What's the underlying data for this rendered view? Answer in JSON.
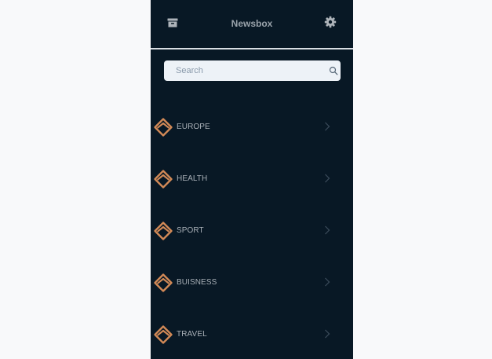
{
  "app": {
    "title": "Newsbox"
  },
  "header": {
    "left_icon": "archive-icon",
    "right_icon": "gear-icon"
  },
  "search": {
    "placeholder": "Search",
    "value": "",
    "icon": "search-icon"
  },
  "categories": [
    {
      "label": "EUROPE"
    },
    {
      "label": "HEALTH"
    },
    {
      "label": "SPORT"
    },
    {
      "label": "BUISNESS"
    },
    {
      "label": "TRAVEL"
    }
  ],
  "colors": {
    "page_background": "#f8f9fa",
    "app_background": "#081825",
    "accent": "#d38a57",
    "text_muted": "#a9b0b7",
    "search_background": "#edf2f7"
  }
}
